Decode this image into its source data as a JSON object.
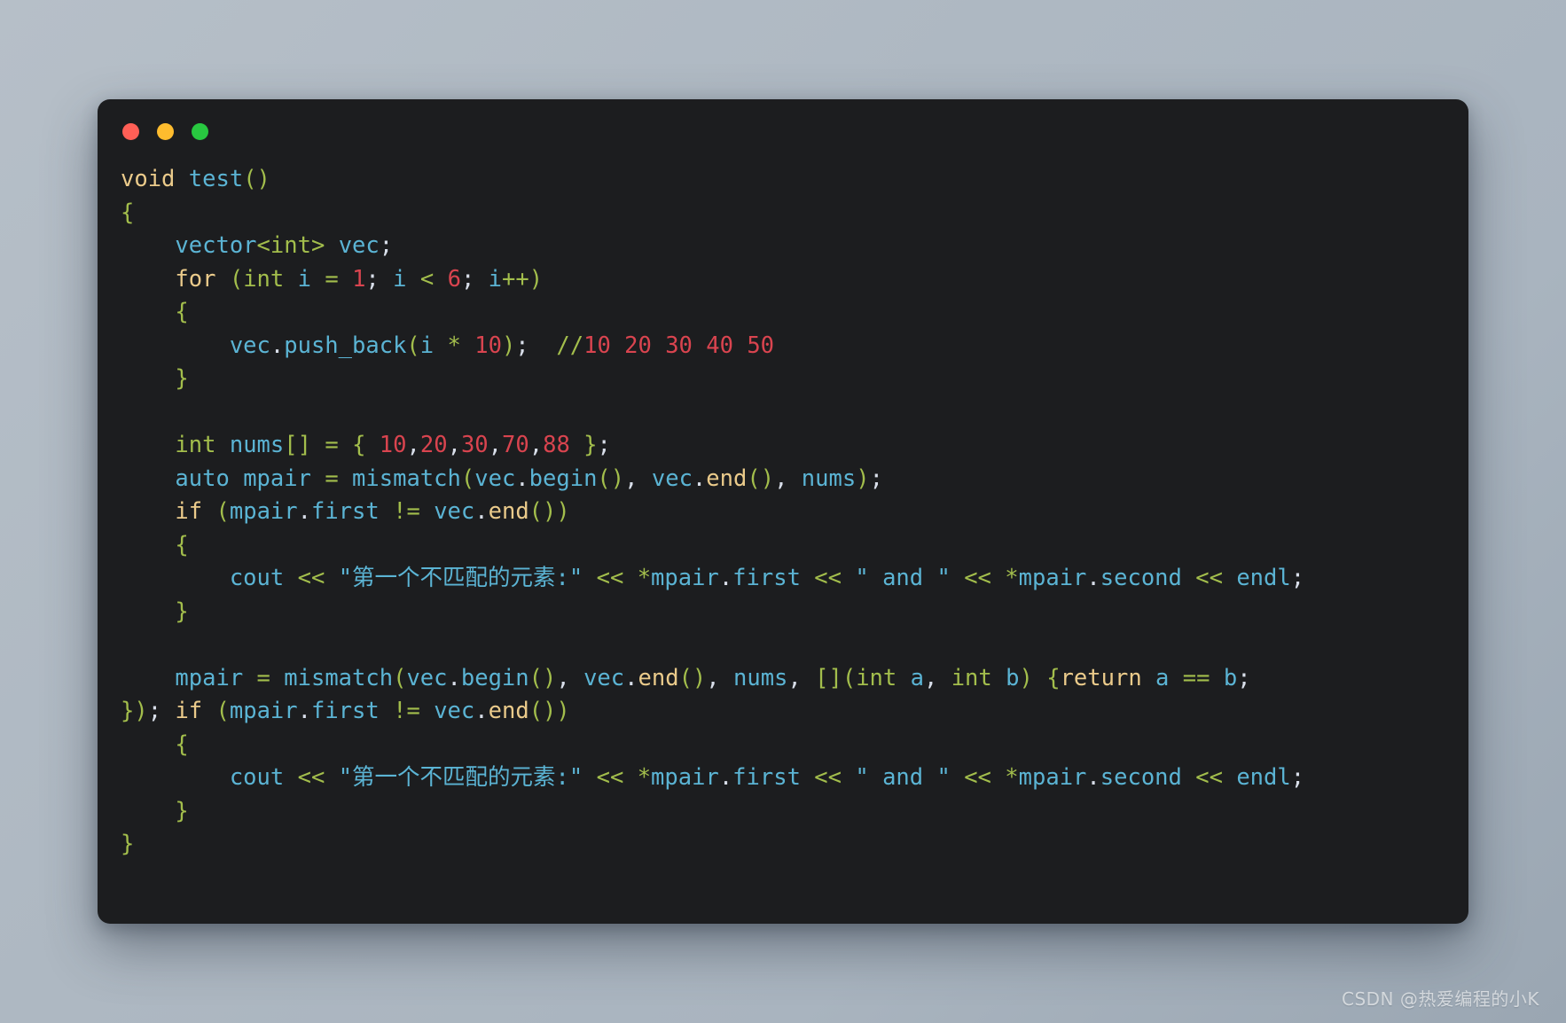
{
  "background": {
    "gradient_from": "#b6bfc8",
    "gradient_to": "#9aa6b2"
  },
  "window": {
    "background": "#1c1d1f",
    "traffic_lights": [
      {
        "name": "close",
        "label": "close",
        "color": "#ff5f56"
      },
      {
        "name": "minimize",
        "label": "minimize",
        "color": "#febc2e"
      },
      {
        "name": "maximize",
        "label": "maximize",
        "color": "#28c840"
      }
    ]
  },
  "editor": {
    "language": "C++",
    "theme_colors": {
      "keyword": "#ebcb8b",
      "identifier": "#5bb4d4",
      "punctuation": "#a3be4c",
      "number": "#d9444f",
      "comment": "#a3be4c",
      "default": "#d8dee9"
    },
    "lines": [
      "void test()",
      "{",
      "    vector<int> vec;",
      "    for (int i = 1; i < 6; i++)",
      "    {",
      "        vec.push_back(i * 10);  //10 20 30 40 50",
      "    }",
      "",
      "    int nums[] = { 10,20,30,70,88 };",
      "    auto mpair = mismatch(vec.begin(), vec.end(), nums);",
      "    if (mpair.first != vec.end())",
      "    {",
      "        cout << \"第一个不匹配的元素:\" << *mpair.first << \" and \" << *mpair.second << endl;",
      "    }",
      "",
      "    mpair = mismatch(vec.begin(), vec.end(), nums, [](int a, int b) {return a == b;});  if (mpair.first != vec.end())",
      "    {",
      "        cout << \"第一个不匹配的元素:\" << *mpair.first << \" and \" << *mpair.second << endl;",
      "    }",
      "}"
    ],
    "tokens": {
      "void": "void",
      "test_call": "test()",
      "open_brace": "{",
      "close_brace": "}",
      "vector_type": "vector",
      "int_generic": "<int>",
      "vec_name": "vec",
      "semicolon": ";",
      "for_kw": "for",
      "int_kw": "int",
      "i_var": "i",
      "assign": "=",
      "one": "1",
      "lt": "<",
      "six": "6",
      "incr": "i++",
      "push_back": "vec.push_back",
      "i_times": "i * 10",
      "comment_slashes": "//",
      "comment_nums": "10 20 30 40 50",
      "nums_decl": "nums[]",
      "array_values": "10,20,30,70,88",
      "auto_kw": "auto",
      "mpair": "mpair",
      "mismatch": "mismatch",
      "vec_begin": "vec.begin()",
      "vec_end": "vec.end()",
      "nums_arg": "nums",
      "if_kw": "if",
      "mpair_first": "mpair.first",
      "neq": "!=",
      "cout": "cout",
      "shift": "<<",
      "chinese_string": "\"第一个不匹配的元素:\"",
      "deref_first": "*mpair.first",
      "and_string": "\" and \"",
      "deref_second": "*mpair.second",
      "endl": "endl",
      "lambda_capture": "[]",
      "lambda_params": "(int a, int b)",
      "return_kw": "return",
      "a_eq_b": "a == b",
      "lambda_close": "});"
    }
  },
  "watermark": {
    "text": "CSDN @热爱编程的小K"
  }
}
